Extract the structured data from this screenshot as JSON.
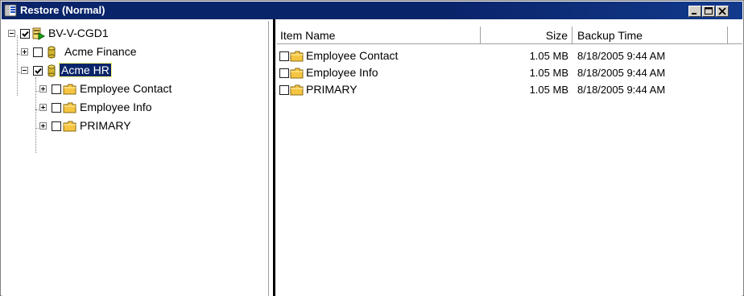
{
  "window": {
    "title": "Restore (Normal)",
    "icon": "restore-app-icon",
    "controls": [
      "minimize-icon",
      "maximize-icon",
      "close-icon"
    ]
  },
  "tree": {
    "server": {
      "label": "BV-V-CGD1",
      "checked": true,
      "icon": "server-icon"
    },
    "databases": [
      {
        "label": "Acme Finance",
        "checked": false,
        "expanded": false,
        "icon": "database-icon"
      },
      {
        "label": "Acme HR",
        "checked": true,
        "expanded": true,
        "selected": true,
        "icon": "database-icon"
      }
    ],
    "folders": [
      {
        "label": "Employee Contact",
        "checked": false,
        "icon": "folder-icon"
      },
      {
        "label": "Employee Info",
        "checked": false,
        "icon": "folder-icon"
      },
      {
        "label": "PRIMARY",
        "checked": false,
        "icon": "folder-icon"
      }
    ]
  },
  "list": {
    "columns": {
      "item_name": "Item Name",
      "size": "Size",
      "backup_time": "Backup Time"
    },
    "rows": [
      {
        "name": "Employee Contact",
        "size": "1.05 MB",
        "time": "8/18/2005  9:44 AM"
      },
      {
        "name": "Employee Info",
        "size": "1.05 MB",
        "time": "8/18/2005  9:44 AM"
      },
      {
        "name": "PRIMARY",
        "size": "1.05 MB",
        "time": "8/18/2005  9:44 AM"
      }
    ]
  },
  "colors": {
    "titlebar": "#0a246a",
    "selection": "#0a246a",
    "folder": "#f5c542",
    "database": "#d6b531"
  }
}
